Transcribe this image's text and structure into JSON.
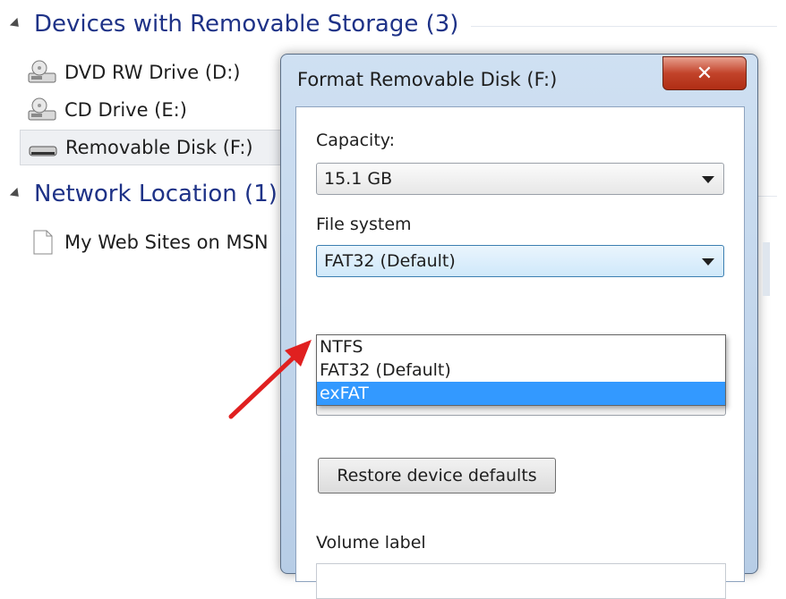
{
  "explorer": {
    "groups": [
      {
        "title": "Devices with Removable Storage (3)"
      },
      {
        "title": "Network Location (1)"
      }
    ],
    "items": [
      {
        "label": "DVD RW Drive (D:)",
        "icon": "dvd-drive-icon"
      },
      {
        "label": "CD Drive (E:)",
        "icon": "cd-drive-icon"
      },
      {
        "label": "Removable Disk (F:)",
        "icon": "removable-disk-icon",
        "selected": true
      },
      {
        "label": "My Web Sites on MSN",
        "icon": "document-icon"
      }
    ]
  },
  "dialog": {
    "title": "Format Removable Disk (F:)",
    "close_label": "✕",
    "capacity_label": "Capacity:",
    "capacity_value": "15.1 GB",
    "filesystem_label": "File system",
    "filesystem_value": "FAT32 (Default)",
    "filesystem_options": [
      {
        "label": "NTFS",
        "highlighted": false
      },
      {
        "label": "FAT32 (Default)",
        "highlighted": false
      },
      {
        "label": "exFAT",
        "highlighted": true
      }
    ],
    "restore_button": "Restore device defaults",
    "volume_label": "Volume label",
    "volume_value": ""
  },
  "colors": {
    "group_header": "#1e3287",
    "highlight": "#3399ff",
    "annotation_arrow": "#e02020",
    "close_button": "#c2432a"
  }
}
